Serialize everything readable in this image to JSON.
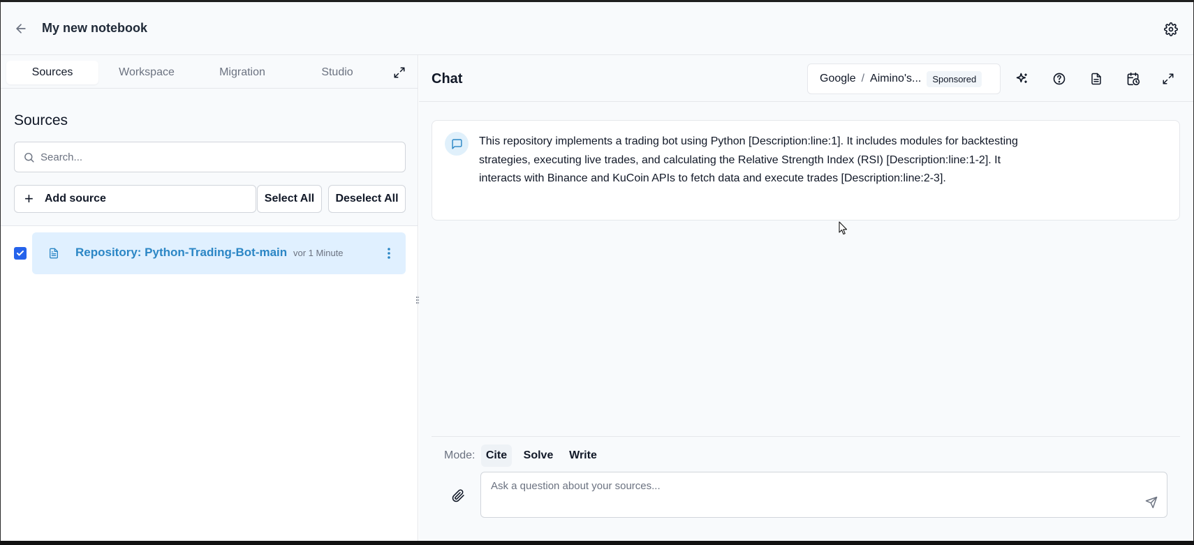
{
  "header": {
    "title": "My new notebook",
    "back_icon": "arrow-left-icon",
    "settings_icon": "gear-icon"
  },
  "left_panel": {
    "tabs": [
      {
        "label": "Sources",
        "active": true
      },
      {
        "label": "Workspace",
        "active": false
      },
      {
        "label": "Migration",
        "active": false
      },
      {
        "label": "Studio",
        "active": false
      }
    ],
    "heading": "Sources",
    "search": {
      "placeholder": "Search...",
      "value": ""
    },
    "add_source_label": "Add source",
    "select_all_label": "Select All",
    "deselect_all_label": "Deselect All",
    "sources": [
      {
        "name": "Repository: Python-Trading-Bot-main",
        "time": "vor 1 Minute",
        "checked": true
      }
    ]
  },
  "chat": {
    "title": "Chat",
    "model": {
      "provider": "Google",
      "name": "Aimino's...",
      "badge": "Sponsored"
    },
    "header_icons": [
      "sparkles-icon",
      "help-circle-icon",
      "document-icon",
      "calendar-clock-icon",
      "expand-icon"
    ],
    "message": "This repository implements a trading bot using Python [Description:line:1]. It includes modules for backtesting strategies, executing live trades, and calculating the Relative Strength Index (RSI) [Description:line:1-2]. It interacts with Binance and KuCoin APIs to fetch data and execute trades [Description:line:2-3].",
    "mode_label": "Mode:",
    "modes": [
      {
        "label": "Cite",
        "active": true
      },
      {
        "label": "Solve",
        "active": false
      },
      {
        "label": "Write",
        "active": false
      }
    ],
    "input_placeholder": "Ask a question about your sources...",
    "input_value": ""
  },
  "colors": {
    "accent": "#2563eb",
    "source_row_bg": "#e0f0ff",
    "source_name": "#2b86c5",
    "panel_bg": "#f8fafc"
  }
}
